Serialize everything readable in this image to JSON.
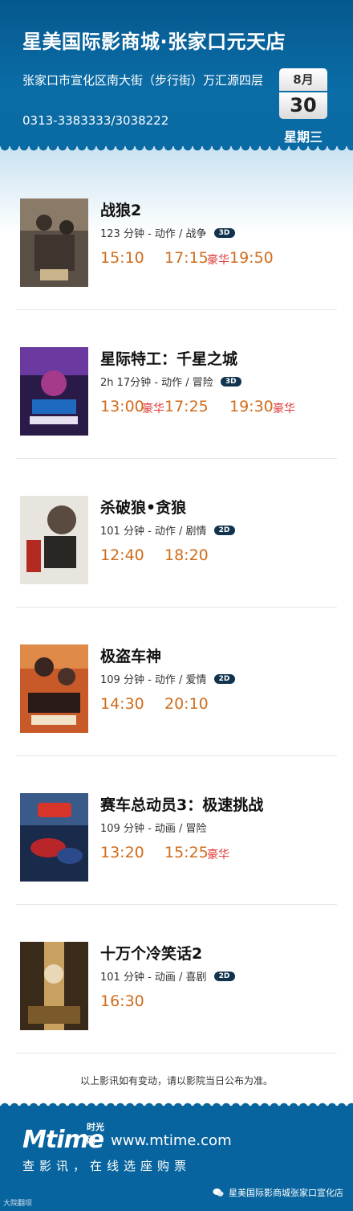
{
  "cinema": {
    "title": "星美国际影商城·张家口元天店",
    "address": "张家口市宣化区南大街（步行街）万汇源四层",
    "phone": "0313-3383333/3038222"
  },
  "date": {
    "month": "8月",
    "day": "30",
    "weekday": "星期三"
  },
  "movies": [
    {
      "title": "战狼2",
      "meta": "123 分钟 - 动作 / 战争",
      "format": "3D",
      "times": [
        {
          "t": "15:10"
        },
        {
          "t": "17:15",
          "lux": "豪华"
        },
        {
          "t": "19:50"
        }
      ]
    },
    {
      "title": "星际特工：千星之城",
      "meta": "2h  17分钟 - 动作 / 冒险",
      "format": "3D",
      "times": [
        {
          "t": "13:00",
          "lux": "豪华"
        },
        {
          "t": "17:25"
        },
        {
          "t": "19:30",
          "lux": "豪华"
        }
      ]
    },
    {
      "title": "杀破狼•贪狼",
      "meta": "101 分钟 - 动作 / 剧情",
      "format": "2D",
      "times": [
        {
          "t": "12:40"
        },
        {
          "t": "18:20"
        }
      ]
    },
    {
      "title": "极盗车神",
      "meta": "109 分钟 - 动作 / 爱情",
      "format": "2D",
      "times": [
        {
          "t": "14:30"
        },
        {
          "t": "20:10"
        }
      ]
    },
    {
      "title": "赛车总动员3：极速挑战",
      "meta": "109 分钟 - 动画 / 冒险",
      "format": "",
      "times": [
        {
          "t": "13:20"
        },
        {
          "t": "15:25",
          "lux": "豪华"
        }
      ]
    },
    {
      "title": "十万个冷笑话2",
      "meta": "101 分钟 - 动画 / 喜剧",
      "format": "2D",
      "times": [
        {
          "t": "16:30"
        }
      ]
    }
  ],
  "notice": "以上影讯如有变动，请以影院当日公布为准。",
  "footer": {
    "brand_cn": "时光网",
    "brand_en": "Mtime",
    "url": "www.mtime.com",
    "slogan": "查影讯，在线选座购票",
    "watermark_left": "大院翻坝",
    "watermark_right": "星美国际影商城张家口宣化店"
  },
  "colors": {
    "header_blue": "#0a6aa3",
    "time_orange": "#d06c1c",
    "luxury_red": "#e03838"
  }
}
